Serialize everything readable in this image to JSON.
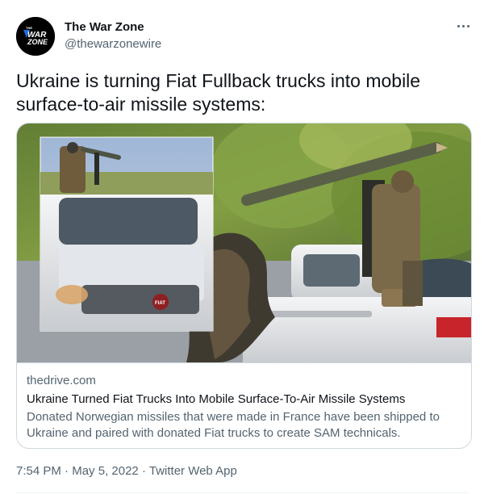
{
  "author": {
    "display_name": "The War Zone",
    "handle": "@thewarzonewire",
    "avatar_logo_text": "THE WAR ZONE"
  },
  "more_icon": "more-horizontal-icon",
  "tweet": {
    "text": "Ukraine is turning Fiat Fullback trucks into mobile\nsurface-to-air missile systems:"
  },
  "card": {
    "domain": "thedrive.com",
    "title": "Ukraine Turned Fiat Trucks Into Mobile Surface-To-Air Missile Systems",
    "description": "Donated Norwegian missiles that were made in France have been shipped to Ukraine and paired with donated Fiat trucks to create SAM technicals.",
    "image_badge": "FIAT"
  },
  "meta": {
    "time": "7:54 PM",
    "separator": "·",
    "date": "May 5, 2022",
    "source": "Twitter Web App"
  },
  "colors": {
    "text_primary": "#0f1419",
    "text_secondary": "#536471",
    "border": "#cfd9de",
    "avatar_bg": "#000000",
    "avatar_accent": "#1d6fd6"
  }
}
